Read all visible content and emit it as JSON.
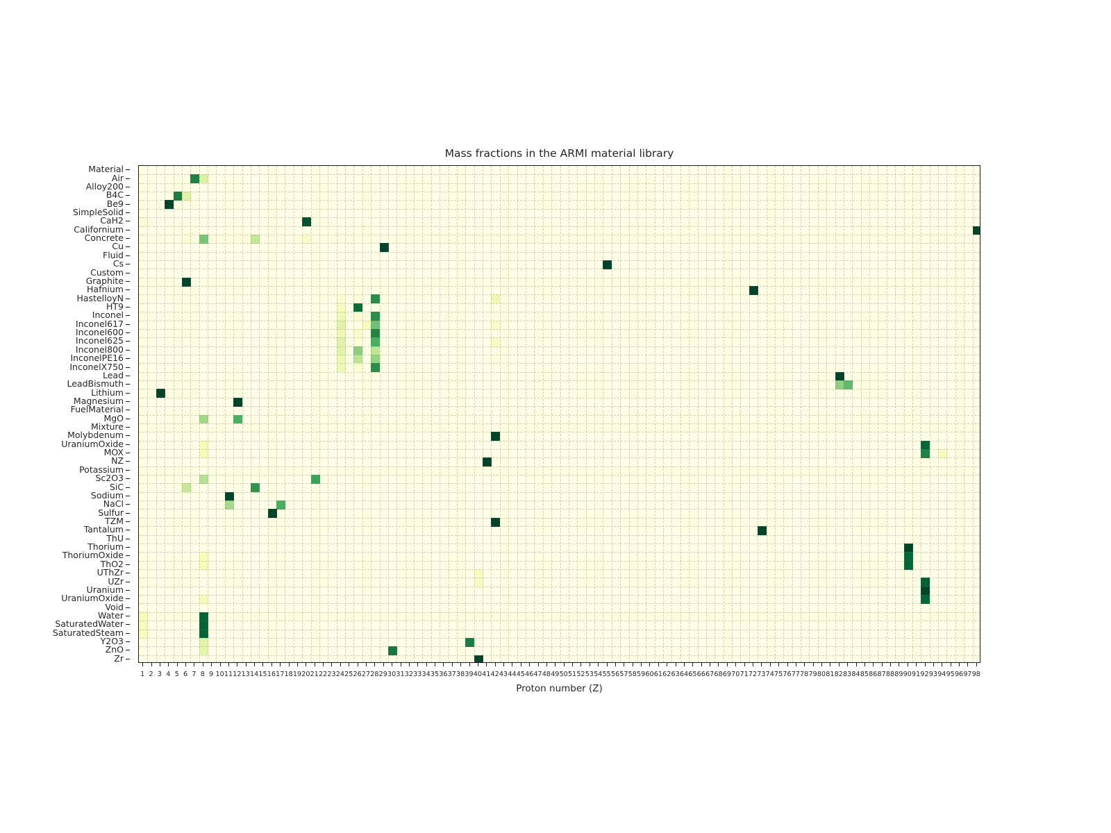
{
  "chart_data": {
    "type": "heatmap",
    "title": "Mass fractions in the ARMI material library",
    "xlabel": "Proton number (Z)",
    "ylabel": "",
    "colormap": "YlGn",
    "colormap_low": "#ffffe5",
    "colormap_high": "#004529",
    "zlim": [
      0,
      1
    ],
    "grid": true,
    "legend": "none",
    "xlim": [
      1,
      98
    ],
    "x": [
      1,
      2,
      3,
      4,
      5,
      6,
      7,
      8,
      9,
      10,
      11,
      12,
      13,
      14,
      15,
      16,
      17,
      18,
      19,
      20,
      21,
      22,
      23,
      24,
      25,
      26,
      27,
      28,
      29,
      30,
      31,
      32,
      33,
      34,
      35,
      36,
      37,
      38,
      39,
      40,
      41,
      42,
      43,
      44,
      45,
      46,
      47,
      48,
      49,
      50,
      51,
      52,
      53,
      54,
      55,
      56,
      57,
      58,
      59,
      60,
      61,
      62,
      63,
      64,
      65,
      66,
      67,
      68,
      69,
      70,
      71,
      72,
      73,
      74,
      75,
      76,
      77,
      78,
      79,
      80,
      81,
      82,
      83,
      84,
      85,
      86,
      87,
      88,
      89,
      90,
      91,
      92,
      93,
      94,
      95,
      96,
      97,
      98
    ],
    "xticklabels": [
      "1",
      "2",
      "3",
      "4",
      "5",
      "6",
      "7",
      "8",
      "9",
      "10",
      "11",
      "12",
      "13",
      "14",
      "15",
      "16",
      "17",
      "18",
      "19",
      "20",
      "21",
      "22",
      "23",
      "24",
      "25",
      "26",
      "27",
      "28",
      "29",
      "30",
      "31",
      "32",
      "33",
      "34",
      "35",
      "36",
      "37",
      "38",
      "39",
      "40",
      "41",
      "42",
      "43",
      "44",
      "45",
      "46",
      "47",
      "48",
      "49",
      "50",
      "51",
      "52",
      "53",
      "54",
      "55",
      "56",
      "57",
      "58",
      "59",
      "60",
      "61",
      "62",
      "63",
      "64",
      "65",
      "66",
      "67",
      "68",
      "69",
      "70",
      "71",
      "72",
      "73",
      "74",
      "75",
      "76",
      "77",
      "78",
      "79",
      "80",
      "81",
      "82",
      "83",
      "84",
      "85",
      "86",
      "87",
      "88",
      "89",
      "90",
      "91",
      "92",
      "93",
      "94",
      "95",
      "96",
      "97",
      "98"
    ],
    "categories": [
      "Material",
      "Air",
      "Alloy200",
      "B4C",
      "Be9",
      "SimpleSolid",
      "CaH2",
      "Californium",
      "Concrete",
      "Cu",
      "Fluid",
      "Cs",
      "Custom",
      "Graphite",
      "Hafnium",
      "HastelloyN",
      "HT9",
      "Inconel",
      "Inconel617",
      "Inconel600",
      "Inconel625",
      "Inconel800",
      "InconelPE16",
      "InconelX750",
      "Lead",
      "LeadBismuth",
      "Lithium",
      "Magnesium",
      "FuelMaterial",
      "MgO",
      "Mixture",
      "Molybdenum",
      "UraniumOxide",
      "MOX",
      "NZ",
      "Potassium",
      "Sc2O3",
      "SiC",
      "Sodium",
      "NaCl",
      "Sulfur",
      "TZM",
      "Tantalum",
      "ThU",
      "Thorium",
      "ThoriumOxide",
      "ThO2",
      "UThZr",
      "UZr",
      "Uranium",
      "UraniumOxide",
      "Void",
      "Water",
      "SaturatedWater",
      "SaturatedSteam",
      "Y2O3",
      "ZnO",
      "Zr"
    ],
    "points": [
      {
        "row": "Air",
        "z": 7,
        "v": 0.76
      },
      {
        "row": "Air",
        "z": 8,
        "v": 0.24
      },
      {
        "row": "B4C",
        "z": 5,
        "v": 0.78
      },
      {
        "row": "B4C",
        "z": 6,
        "v": 0.22
      },
      {
        "row": "Be9",
        "z": 4,
        "v": 1.0
      },
      {
        "row": "CaH2",
        "z": 1,
        "v": 0.05
      },
      {
        "row": "CaH2",
        "z": 20,
        "v": 0.95
      },
      {
        "row": "Concrete",
        "z": 1,
        "v": 0.01
      },
      {
        "row": "Concrete",
        "z": 6,
        "v": 0.05
      },
      {
        "row": "Concrete",
        "z": 8,
        "v": 0.5
      },
      {
        "row": "Concrete",
        "z": 11,
        "v": 0.02
      },
      {
        "row": "Concrete",
        "z": 12,
        "v": 0.01
      },
      {
        "row": "Concrete",
        "z": 13,
        "v": 0.03
      },
      {
        "row": "Concrete",
        "z": 14,
        "v": 0.31
      },
      {
        "row": "Concrete",
        "z": 19,
        "v": 0.01
      },
      {
        "row": "Concrete",
        "z": 20,
        "v": 0.08
      },
      {
        "row": "Concrete",
        "z": 26,
        "v": 0.01
      },
      {
        "row": "Californium",
        "z": 98,
        "v": 1.0
      },
      {
        "row": "Cu",
        "z": 29,
        "v": 1.0
      },
      {
        "row": "Cs",
        "z": 55,
        "v": 1.0
      },
      {
        "row": "Graphite",
        "z": 6,
        "v": 1.0
      },
      {
        "row": "Hafnium",
        "z": 72,
        "v": 1.0
      },
      {
        "row": "HastelloyN",
        "z": 24,
        "v": 0.07
      },
      {
        "row": "HastelloyN",
        "z": 26,
        "v": 0.04
      },
      {
        "row": "HastelloyN",
        "z": 28,
        "v": 0.72
      },
      {
        "row": "HastelloyN",
        "z": 42,
        "v": 0.16
      },
      {
        "row": "HT9",
        "z": 6,
        "v": 0.002
      },
      {
        "row": "HT9",
        "z": 24,
        "v": 0.12
      },
      {
        "row": "HT9",
        "z": 26,
        "v": 0.85
      },
      {
        "row": "HT9",
        "z": 42,
        "v": 0.01
      },
      {
        "row": "Inconel",
        "z": 24,
        "v": 0.155
      },
      {
        "row": "Inconel",
        "z": 26,
        "v": 0.07
      },
      {
        "row": "Inconel",
        "z": 27,
        "v": 0.01
      },
      {
        "row": "Inconel",
        "z": 28,
        "v": 0.72
      },
      {
        "row": "Inconel617",
        "z": 24,
        "v": 0.22
      },
      {
        "row": "Inconel617",
        "z": 26,
        "v": 0.015
      },
      {
        "row": "Inconel617",
        "z": 27,
        "v": 0.125
      },
      {
        "row": "Inconel617",
        "z": 28,
        "v": 0.52
      },
      {
        "row": "Inconel617",
        "z": 42,
        "v": 0.09
      },
      {
        "row": "Inconel600",
        "z": 24,
        "v": 0.155
      },
      {
        "row": "Inconel600",
        "z": 26,
        "v": 0.08
      },
      {
        "row": "Inconel600",
        "z": 28,
        "v": 0.755
      },
      {
        "row": "Inconel625",
        "z": 24,
        "v": 0.215
      },
      {
        "row": "Inconel625",
        "z": 26,
        "v": 0.05
      },
      {
        "row": "Inconel625",
        "z": 28,
        "v": 0.61
      },
      {
        "row": "Inconel625",
        "z": 42,
        "v": 0.09
      },
      {
        "row": "Inconel800",
        "z": 24,
        "v": 0.21
      },
      {
        "row": "Inconel800",
        "z": 26,
        "v": 0.455
      },
      {
        "row": "Inconel800",
        "z": 28,
        "v": 0.325
      },
      {
        "row": "InconelPE16",
        "z": 24,
        "v": 0.165
      },
      {
        "row": "InconelPE16",
        "z": 26,
        "v": 0.33
      },
      {
        "row": "InconelPE16",
        "z": 28,
        "v": 0.435
      },
      {
        "row": "InconelPE16",
        "z": 42,
        "v": 0.03
      },
      {
        "row": "InconelX750",
        "z": 24,
        "v": 0.155
      },
      {
        "row": "InconelX750",
        "z": 26,
        "v": 0.07
      },
      {
        "row": "InconelX750",
        "z": 28,
        "v": 0.72
      },
      {
        "row": "Lead",
        "z": 82,
        "v": 1.0
      },
      {
        "row": "LeadBismuth",
        "z": 82,
        "v": 0.445
      },
      {
        "row": "LeadBismuth",
        "z": 83,
        "v": 0.555
      },
      {
        "row": "Lithium",
        "z": 3,
        "v": 1.0
      },
      {
        "row": "Magnesium",
        "z": 12,
        "v": 1.0
      },
      {
        "row": "MgO",
        "z": 8,
        "v": 0.4
      },
      {
        "row": "MgO",
        "z": 12,
        "v": 0.6
      },
      {
        "row": "Molybdenum",
        "z": 42,
        "v": 1.0
      },
      {
        "row": "UraniumOxide",
        "z": 8,
        "v": 0.12
      },
      {
        "row": "UraniumOxide",
        "z": 92,
        "v": 0.88
      },
      {
        "row": "MOX",
        "z": 8,
        "v": 0.12
      },
      {
        "row": "MOX",
        "z": 92,
        "v": 0.76
      },
      {
        "row": "MOX",
        "z": 94,
        "v": 0.12
      },
      {
        "row": "NZ",
        "z": 41,
        "v": 1.0
      },
      {
        "row": "Sc2O3",
        "z": 8,
        "v": 0.35
      },
      {
        "row": "Sc2O3",
        "z": 21,
        "v": 0.65
      },
      {
        "row": "SiC",
        "z": 6,
        "v": 0.3
      },
      {
        "row": "SiC",
        "z": 14,
        "v": 0.7
      },
      {
        "row": "Sodium",
        "z": 11,
        "v": 1.0
      },
      {
        "row": "NaCl",
        "z": 11,
        "v": 0.39
      },
      {
        "row": "NaCl",
        "z": 17,
        "v": 0.61
      },
      {
        "row": "Sulfur",
        "z": 16,
        "v": 1.0
      },
      {
        "row": "TZM",
        "z": 42,
        "v": 1.0
      },
      {
        "row": "Tantalum",
        "z": 73,
        "v": 1.0
      },
      {
        "row": "Thorium",
        "z": 90,
        "v": 1.0
      },
      {
        "row": "ThoriumOxide",
        "z": 8,
        "v": 0.12
      },
      {
        "row": "ThoriumOxide",
        "z": 90,
        "v": 0.88
      },
      {
        "row": "ThO2",
        "z": 8,
        "v": 0.12
      },
      {
        "row": "ThO2",
        "z": 90,
        "v": 0.88
      },
      {
        "row": "UThZr",
        "z": 40,
        "v": 0.1
      },
      {
        "row": "UZr",
        "z": 40,
        "v": 0.1
      },
      {
        "row": "UZr",
        "z": 92,
        "v": 0.9
      },
      {
        "row": "Uranium",
        "z": 92,
        "v": 1.0
      },
      {
        "row": "UraniumOxide2",
        "z": 8,
        "v": 0.12
      },
      {
        "row": "UraniumOxide2",
        "z": 92,
        "v": 0.88
      },
      {
        "row": "Water",
        "z": 1,
        "v": 0.11
      },
      {
        "row": "Water",
        "z": 8,
        "v": 0.89
      },
      {
        "row": "SaturatedWater",
        "z": 1,
        "v": 0.11
      },
      {
        "row": "SaturatedWater",
        "z": 8,
        "v": 0.89
      },
      {
        "row": "SaturatedSteam",
        "z": 1,
        "v": 0.11
      },
      {
        "row": "SaturatedSteam",
        "z": 8,
        "v": 0.89
      },
      {
        "row": "Y2O3",
        "z": 8,
        "v": 0.21
      },
      {
        "row": "Y2O3",
        "z": 39,
        "v": 0.79
      },
      {
        "row": "ZnO",
        "z": 8,
        "v": 0.2
      },
      {
        "row": "ZnO",
        "z": 30,
        "v": 0.8
      },
      {
        "row": "Zr",
        "z": 40,
        "v": 1.0
      }
    ],
    "yticklabels": [
      "Material",
      "Air",
      "Alloy200",
      "B4C",
      "Be9",
      "SimpleSolid",
      "CaH2",
      "Californium",
      "Concrete",
      "Cu",
      "Fluid",
      "Cs",
      "Custom",
      "Graphite",
      "Hafnium",
      "HastelloyN",
      "HT9",
      "Inconel",
      "Inconel617",
      "Inconel600",
      "Inconel625",
      "Inconel800",
      "InconelPE16",
      "InconelX750",
      "Lead",
      "LeadBismuth",
      "Lithium",
      "Magnesium",
      "FuelMaterial",
      "MgO",
      "Mixture",
      "Molybdenum",
      "UraniumOxide",
      "MOX",
      "NZ",
      "Potassium",
      "Sc2O3",
      "SiC",
      "Sodium",
      "NaCl",
      "Sulfur",
      "TZM",
      "Tantalum",
      "ThU",
      "Thorium",
      "ThoriumOxide",
      "ThO2",
      "UThZr",
      "UZr",
      "Uranium",
      "UraniumOxide",
      "Void",
      "Water",
      "SaturatedWater",
      "SaturatedSteam",
      "Y2O3",
      "ZnO",
      "Zr"
    ]
  },
  "figure": {
    "title": "Mass fractions in the ARMI material library",
    "xaxis_label": "Proton number (Z)"
  }
}
